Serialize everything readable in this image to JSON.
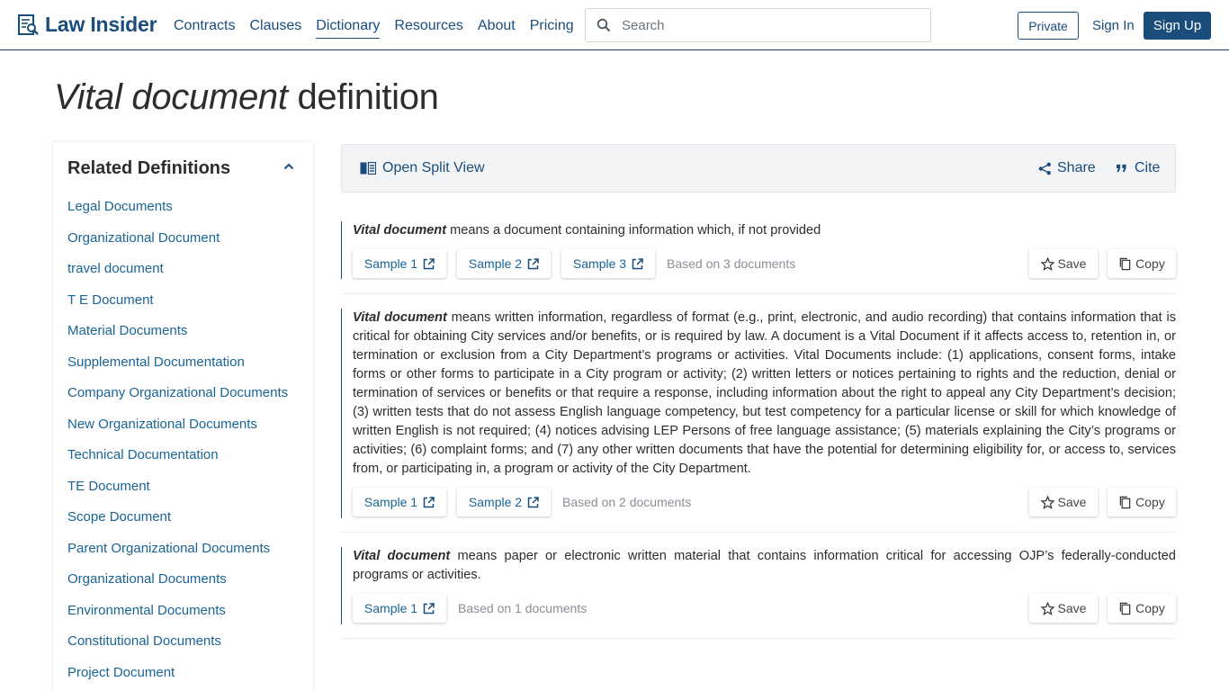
{
  "header": {
    "logo_text": "Law Insider",
    "nav": [
      {
        "label": "Contracts",
        "active": false
      },
      {
        "label": "Clauses",
        "active": false
      },
      {
        "label": "Dictionary",
        "active": true
      },
      {
        "label": "Resources",
        "active": false
      },
      {
        "label": "About",
        "active": false
      },
      {
        "label": "Pricing",
        "active": false
      }
    ],
    "search_placeholder": "Search",
    "private_label": "Private",
    "signin_label": "Sign In",
    "signup_label": "Sign Up"
  },
  "page": {
    "title_term": "Vital document",
    "title_suffix": " definition"
  },
  "sidebar": {
    "heading": "Related Definitions",
    "items": [
      "Legal Documents",
      "Organizational Document",
      "travel document",
      "T E Document",
      "Material Documents",
      "Supplemental Documentation",
      "Company Organizational Documents",
      "New Organizational Documents",
      "Technical Documentation",
      "TE Document",
      "Scope Document",
      "Parent Organizational Documents",
      "Organizational Documents",
      "Environmental Documents",
      "Constitutional Documents",
      "Project Document"
    ]
  },
  "toolbar": {
    "split_label": "Open Split View",
    "share_label": "Share",
    "cite_label": "Cite"
  },
  "definitions": [
    {
      "term": "Vital document",
      "text": " means a document containing information which, if not provided",
      "samples": [
        "Sample 1",
        "Sample 2",
        "Sample 3"
      ],
      "based_on": "Based on 3 documents",
      "save_label": "Save",
      "copy_label": "Copy"
    },
    {
      "term": "Vital document",
      "text": " means written information, regardless of format (e.g., print, electronic, and audio recording) that contains information that is critical for obtaining City services and/or benefits, or is required by law. A document is a Vital Document if it affects access to, retention in, or termination or exclusion from a City Department’s programs or activities. Vital Documents include: (1) applications, consent forms, intake forms or other forms to participate in a City program or activity; (2) written letters or notices pertaining to rights and the reduction, denial or termination of services or benefits or that require a response, including information about the right to appeal any City Department’s decision; (3) written tests that do not assess English language competency, but test competency for a particular license or skill for which knowledge of written English is not required; (4) notices advising LEP Persons of free language assistance; (5) materials explaining the City’s programs or activities; (6) complaint forms; and (7) any other written documents that have the potential for determining eligibility for, or access to, services from, or participating in, a program or activity of the City Department.",
      "samples": [
        "Sample 1",
        "Sample 2"
      ],
      "based_on": "Based on 2 documents",
      "save_label": "Save",
      "copy_label": "Copy"
    },
    {
      "term": "Vital document",
      "text": " means paper or electronic written material that contains information critical for accessing OJP’s federally-conducted programs or activities.",
      "samples": [
        "Sample 1"
      ],
      "based_on": "Based on 1 documents",
      "save_label": "Save",
      "copy_label": "Copy"
    }
  ],
  "colors": {
    "brand": "#1a4d7c",
    "link": "#1a6496",
    "muted": "#8a8f96"
  }
}
